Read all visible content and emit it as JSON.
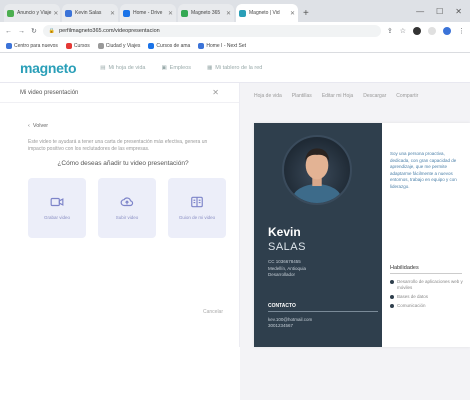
{
  "browser": {
    "tabs": [
      {
        "title": "Anuncio y Viaje",
        "color": "#4caf50"
      },
      {
        "title": "Kevin Salas",
        "color": "#3b73d8"
      },
      {
        "title": "Home - Drive",
        "color": "#1a73e8"
      },
      {
        "title": "Magneto 365",
        "color": "#34a853"
      },
      {
        "title": "Magneto | Vid",
        "color": "#2a9fb8",
        "active": true
      }
    ],
    "url": "perfilmagneto365.com/videopresentacion",
    "bookmarks": [
      "Centro para nuevos",
      "Cursos",
      "Ciudad y Viajes",
      "Cursos de ama",
      "Home I - Next Set"
    ]
  },
  "app": {
    "logo": "magneto",
    "nav": [
      "Mi hoja de vida",
      "Empleos",
      "Mi tablero de la red"
    ]
  },
  "left_panel": {
    "title": "Mi video presentación",
    "back": "Volver",
    "description": "Este video te ayudará a tener una carta de presentación más efectiva, genera un impacto positivo con los reclutadores de las empresas.",
    "question": "¿Cómo deseas añadir tu video presentación?",
    "options": [
      {
        "label": "Grabar video",
        "icon": "video-camera-icon"
      },
      {
        "label": "Subir video",
        "icon": "cloud-upload-icon"
      },
      {
        "label": "Guion de mi video",
        "icon": "script-icon"
      }
    ],
    "cancel": "Cancelar"
  },
  "preview": {
    "toolbar": [
      "Hoja de vida",
      "Plantillas",
      "Editar mi Hoja",
      "Descargar",
      "Compartir"
    ],
    "first_name": "Kevin",
    "last_name": "SALAS",
    "info": [
      "CC 1036678455",
      "Medellín, Antioquia",
      "Desarrollador"
    ],
    "contact_title": "CONTACTO",
    "contact_lines": [
      "kev.100@hotmail.com",
      "3001234567"
    ],
    "profile_text": "Soy una persona proactiva, dedicada, con gran capacidad de aprendizaje, que me permite adaptarme fácilmente a nuevos entornos, trabajo en equipo y con liderazgo.",
    "skills_title": "Habilidades",
    "skills": [
      "Desarrollo de aplicaciones web y móviles",
      "Bases de datos",
      "Comunicación"
    ],
    "sidebar_color": "#2f3f4d"
  }
}
